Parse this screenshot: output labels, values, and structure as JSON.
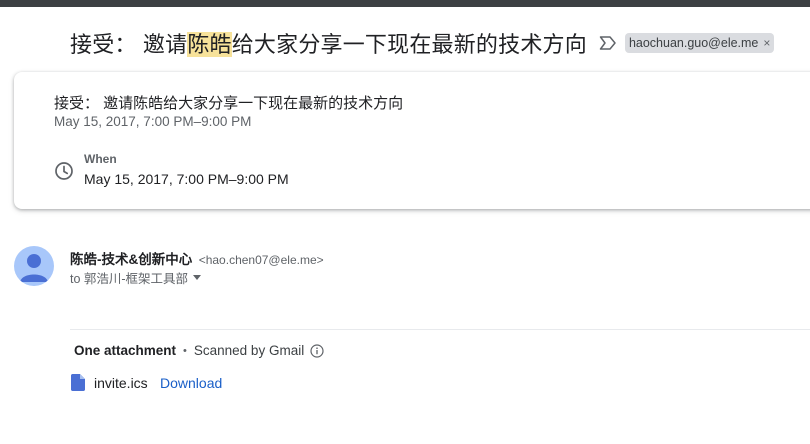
{
  "subject": {
    "prefix": "接受： 邀请",
    "highlight": "陈皓",
    "suffix": "给大家分享一下现在最新的技术方向",
    "label_chip": "haochuan.guo@ele.me",
    "label_chip_remove": "×"
  },
  "invite_card": {
    "title": "接受： 邀请陈皓给大家分享一下现在最新的技术方向",
    "date_range": "May 15, 2017, 7:00 PM–9:00 PM",
    "when_label": "When",
    "when_value": "May 15, 2017, 7:00 PM–9:00 PM"
  },
  "message": {
    "sender_name": "陈皓-技术&创新中心",
    "sender_email": "<hao.chen07@ele.me>",
    "to_text": "to 郭浩川-框架工具部"
  },
  "attachments": {
    "count_label": "One attachment",
    "separator": "•",
    "scan_label": "Scanned by Gmail",
    "file_name": "invite.ics",
    "download_label": "Download"
  },
  "colors": {
    "highlight": "#f7e29a",
    "link": "#1a5fc8",
    "avatar_bg": "#a8c7fa",
    "file_icon": "#4a6fd4"
  }
}
